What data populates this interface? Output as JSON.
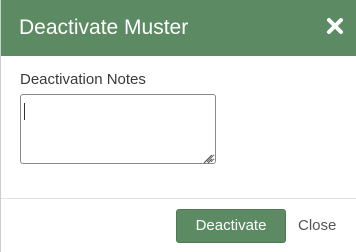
{
  "dialog": {
    "title": "Deactivate Muster",
    "close_icon": "close-icon",
    "notes_label": "Deactivation Notes",
    "notes_value": "",
    "deactivate_label": "Deactivate",
    "close_label": "Close"
  },
  "colors": {
    "header_bg": "#5b8a63",
    "primary_button": "#5b8a63",
    "title_text": "#ffffff"
  }
}
